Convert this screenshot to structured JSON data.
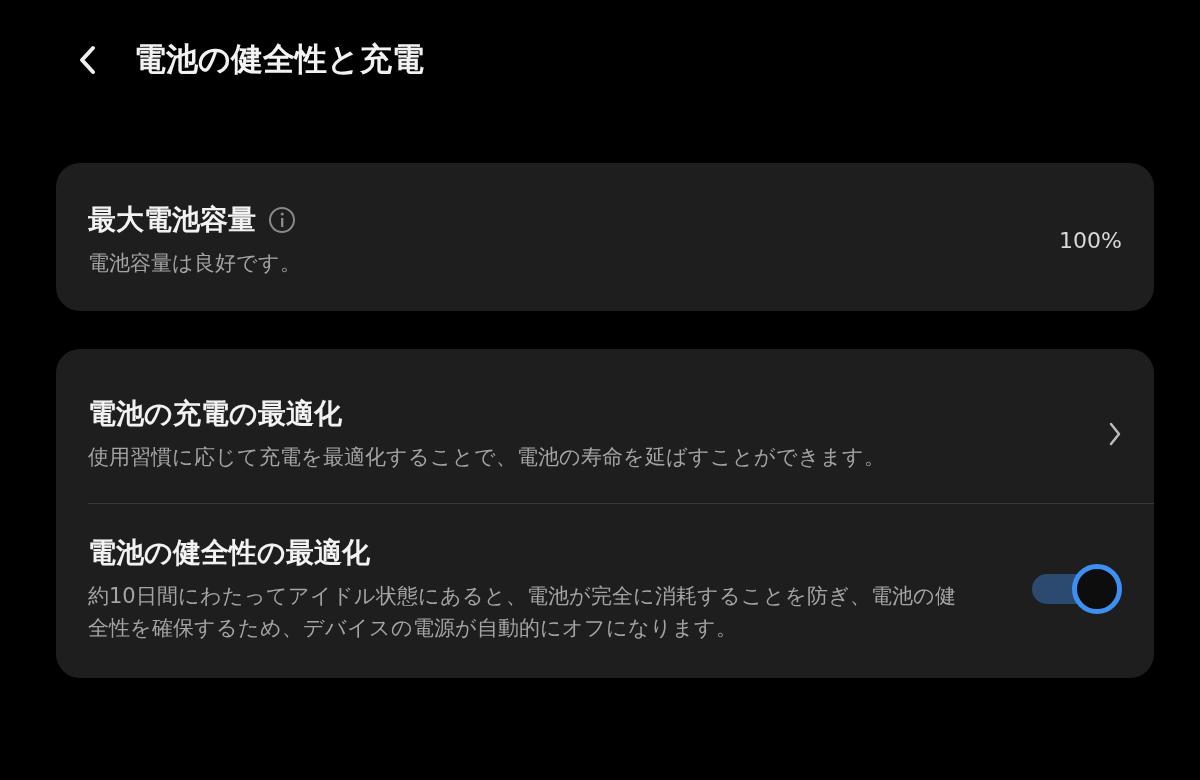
{
  "header": {
    "title": "電池の健全性と充電"
  },
  "capacity": {
    "title": "最大電池容量",
    "subtitle": "電池容量は良好です。",
    "value": "100%"
  },
  "settings": [
    {
      "kind": "link",
      "title": "電池の充電の最適化",
      "description": "使用習慣に応じて充電を最適化することで、電池の寿命を延ばすことができます。"
    },
    {
      "kind": "toggle",
      "title": "電池の健全性の最適化",
      "description": "約10日間にわたってアイドル状態にあると、電池が完全に消耗することを防ぎ、電池の健全性を確保するため、デバイスの電源が自動的にオフになります。",
      "on": true
    }
  ]
}
